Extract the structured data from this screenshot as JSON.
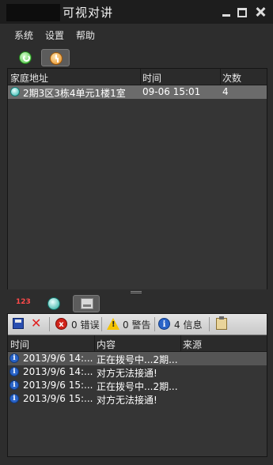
{
  "window": {
    "title": "可视对讲"
  },
  "menu": [
    "系统",
    "设置",
    "帮助"
  ],
  "calls_table": {
    "headers": [
      "家庭地址",
      "时间",
      "次数"
    ],
    "rows": [
      {
        "address": "2期3区3栋4单元1楼1室",
        "time": "09-06 15:01",
        "count": "4"
      }
    ]
  },
  "toolbar2": {
    "counter_icon_text": "123"
  },
  "log_toolbar": {
    "errors": "0 错误",
    "warnings": "0 警告",
    "infos": "4 信息",
    "error_badge": "x",
    "warning_badge": "!",
    "info_badge": "i"
  },
  "log_table": {
    "headers": [
      "时间",
      "内容",
      "来源"
    ],
    "rows": [
      {
        "time": "2013/9/6 14:...",
        "content": "正在拨号中...2期...",
        "source": "",
        "icon": "info-icon"
      },
      {
        "time": "2013/9/6 14:...",
        "content": "对方无法接通!",
        "source": "",
        "icon": "info-icon"
      },
      {
        "time": "2013/9/6 15:...",
        "content": "正在拨号中...2期...",
        "source": "",
        "icon": "info-icon"
      },
      {
        "time": "2013/9/6 15:...",
        "content": "对方无法接通!",
        "source": "",
        "icon": "info-icon"
      }
    ]
  },
  "colors": {
    "selected_row": "#6b6b6b",
    "panel_bg": "#353535",
    "toolbar_bg": "#d6d6d6"
  }
}
